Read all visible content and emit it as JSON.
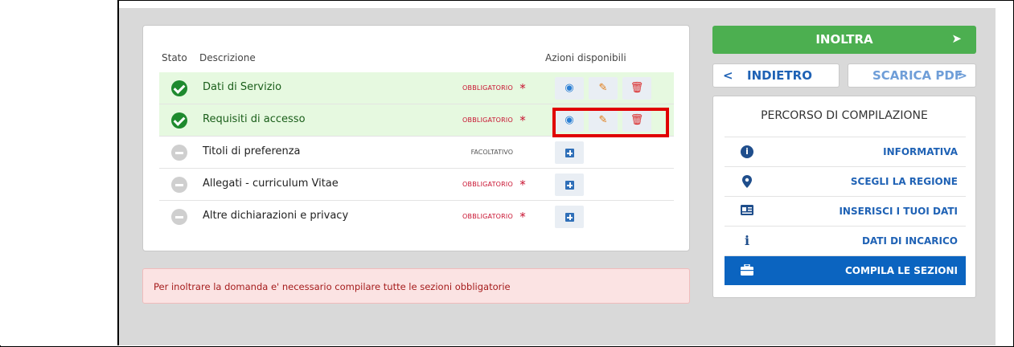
{
  "table": {
    "headers": {
      "stato": "Stato",
      "descrizione": "Descrizione",
      "azioni": "Azioni disponibili"
    },
    "rows": [
      {
        "label": "Dati di Servizio",
        "status": "done",
        "requirement": "OBBLIGATORIO",
        "actions": [
          "view-icon",
          "edit-icon",
          "delete-icon"
        ]
      },
      {
        "label": "Requisiti di accesso",
        "status": "done",
        "requirement": "OBBLIGATORIO",
        "actions": [
          "view-icon",
          "edit-icon",
          "delete-icon"
        ]
      },
      {
        "label": "Titoli di preferenza",
        "status": "empty",
        "requirement": "FACOLTATIVO",
        "actions": [
          "add-icon"
        ]
      },
      {
        "label": "Allegati - curriculum Vitae",
        "status": "empty",
        "requirement": "OBBLIGATORIO",
        "actions": [
          "add-icon"
        ]
      },
      {
        "label": "Altre dichiarazioni e privacy",
        "status": "empty",
        "requirement": "OBBLIGATORIO",
        "actions": [
          "add-icon"
        ]
      }
    ],
    "required_mark": "*"
  },
  "alert": {
    "message": "Per inoltrare la domanda e' necessario compilare tutte le sezioni obbligatorie"
  },
  "actions": {
    "inoltra_label": "INOLTRA",
    "back_label": "INDIETRO",
    "pdf_label": "SCARICA PDF",
    "back_chevron": "<",
    "pdf_chevron": ">"
  },
  "percorso": {
    "title": "PERCORSO DI COMPILAZIONE",
    "steps": [
      {
        "label": "INFORMATIVA",
        "icon": "info-circle-icon",
        "active": false
      },
      {
        "label": "SCEGLI LA REGIONE",
        "icon": "map-marker-icon",
        "active": false
      },
      {
        "label": "INSERISCI I TUOI DATI",
        "icon": "id-card-icon",
        "active": false
      },
      {
        "label": "DATI DI INCARICO",
        "icon": "info-icon",
        "active": false
      },
      {
        "label": "COMPILA LE SEZIONI",
        "icon": "briefcase-icon",
        "active": true
      }
    ]
  },
  "colors": {
    "accent_green": "#4caf50",
    "accent_blue": "#0b64c0",
    "required_red": "#c8102e",
    "highlight_red": "#e00000"
  }
}
